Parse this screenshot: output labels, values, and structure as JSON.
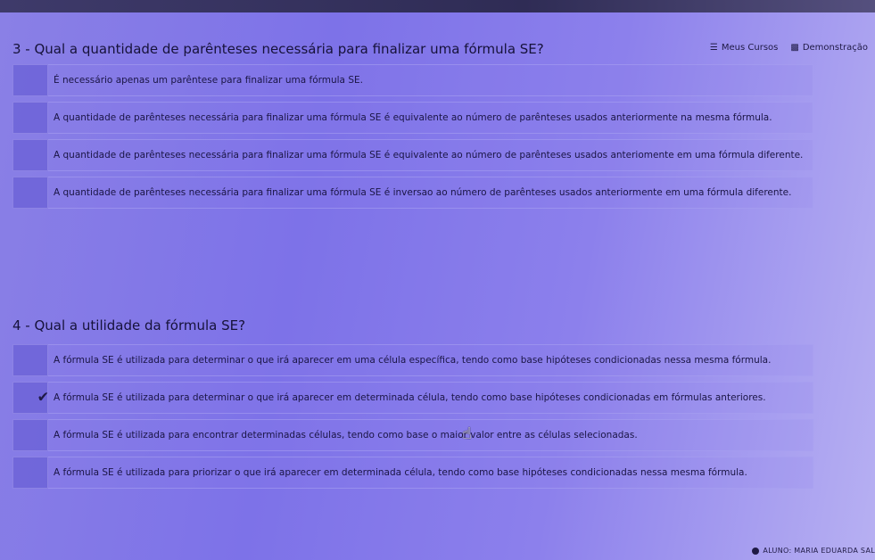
{
  "nav": {
    "courses_label": "Meus Cursos",
    "demo_label": "Demonstração"
  },
  "q3": {
    "title": "3 - Qual a quantidade de parênteses necessária para finalizar uma fórmula SE?",
    "options": [
      "É necessário apenas um parêntese para finalizar uma fórmula SE.",
      "A quantidade de parênteses necessária para finalizar uma fórmula SE é equivalente ao número de parênteses usados anteriormente na mesma fórmula.",
      "A quantidade de parênteses necessária para finalizar uma fórmula SE é equivalente ao número de parênteses usados anteriomente em uma fórmula diferente.",
      "A quantidade de parênteses necessária para finalizar uma fórmula SE é inversao ao número de parênteses usados anteriormente em uma fórmula diferente."
    ]
  },
  "q4": {
    "title": "4 - Qual a utilidade da fórmula SE?",
    "options": [
      "A fórmula SE é utilizada para determinar o que irá aparecer em uma célula específica, tendo como base hipóteses condicionadas nessa mesma fórmula.",
      "A fórmula SE é utilizada para determinar o que irá aparecer em determinada célula, tendo como base hipóteses condicionadas em fórmulas anteriores.",
      "A fórmula SE é utilizada para encontrar determinadas células, tendo como base o maior valor entre as células selecionadas.",
      "A fórmula SE é utilizada para priorizar o que irá aparecer em determinada célula, tendo como base hipóteses condicionadas nessa mesma fórmula."
    ],
    "selected_index": 1
  },
  "footer": {
    "user_label": "ALUNO: MARIA EDUARDA SAL"
  }
}
